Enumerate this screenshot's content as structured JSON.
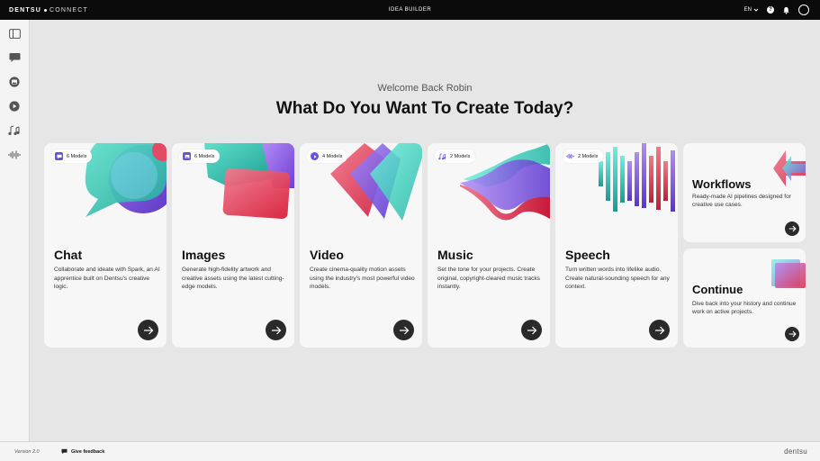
{
  "topbar": {
    "brand_primary": "DENTSU",
    "brand_secondary": "CONNECT",
    "title": "IDEA BUILDER",
    "language": "EN",
    "help_label": "?"
  },
  "sidebar": {
    "items": [
      {
        "icon": "sidebar-toggle-icon"
      },
      {
        "icon": "chat-icon"
      },
      {
        "icon": "image-icon"
      },
      {
        "icon": "play-icon"
      },
      {
        "icon": "music-icon"
      },
      {
        "icon": "waveform-icon"
      }
    ]
  },
  "main": {
    "welcome": "Welcome Back Robin",
    "headline": "What Do You Want To Create Today?"
  },
  "cards": [
    {
      "title": "Chat",
      "badge": "6 Models",
      "icon": "chat-icon",
      "description": "Collaborate and ideate with Spark, an AI apprentice built on Dentsu's creative logic."
    },
    {
      "title": "Images",
      "badge": "6 Models",
      "icon": "image-icon",
      "description": "Generate high-fidelity artwork and creative assets using the latest cutting-edge models."
    },
    {
      "title": "Video",
      "badge": "4 Models",
      "icon": "play-icon",
      "description": "Create cinema-quality motion assets using the industry's most powerful video models."
    },
    {
      "title": "Music",
      "badge": "2 Models",
      "icon": "music-icon",
      "description": "Set the tone for your projects. Create original, copyright-cleared music tracks instantly."
    },
    {
      "title": "Speech",
      "badge": "2 Models",
      "icon": "waveform-icon",
      "description": "Turn written words into lifelike audio. Create natural-sounding speech for any context."
    }
  ],
  "side_cards": [
    {
      "title": "Workflows",
      "description": "Ready-made AI pipelines designed for creative use cases."
    },
    {
      "title": "Continue",
      "description": "Dive back into your history and continue work on active projects."
    }
  ],
  "footer": {
    "version": "Version 2.0",
    "feedback": "Give feedback",
    "logo": "dentsu"
  },
  "colors": {
    "topbar": "#0b0b0b",
    "background": "#e6e6e6",
    "card": "#f7f7f7",
    "accent_teal": "#3cc9b8",
    "accent_purple": "#7b4fd6",
    "accent_red": "#e0344f"
  }
}
